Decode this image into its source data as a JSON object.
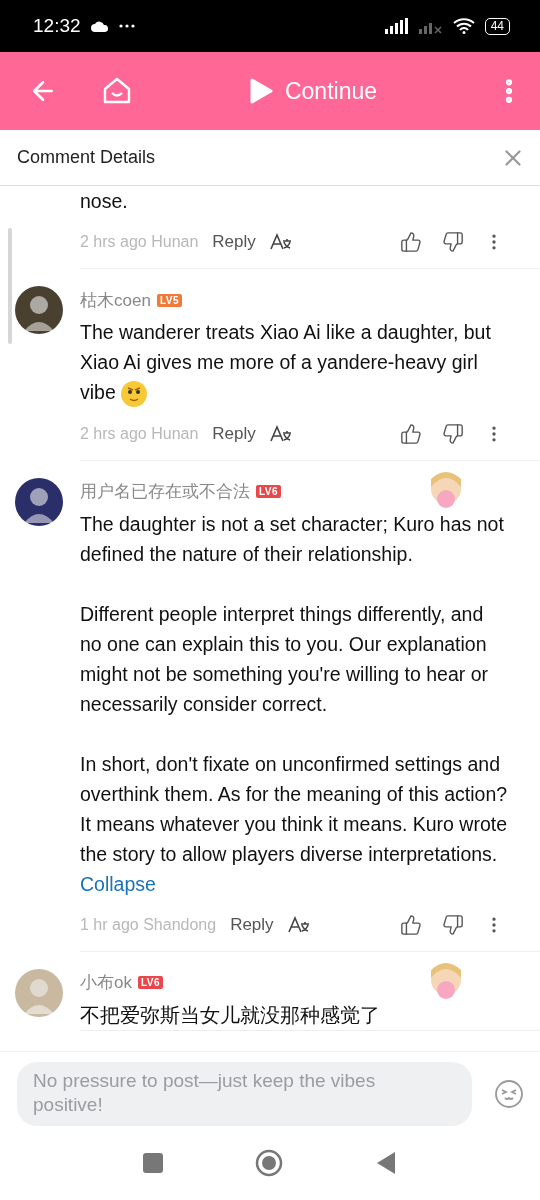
{
  "status_bar": {
    "time": "12:32",
    "battery": "44"
  },
  "header": {
    "title": "Continue"
  },
  "panel": {
    "title": "Comment Details"
  },
  "comments": [
    {
      "kind": "partial",
      "paragraphs": [
        "nose."
      ],
      "time": "2 hrs ago",
      "location": "Hunan",
      "reply": "Reply"
    },
    {
      "kind": "full",
      "user": "枯木coen",
      "badge": {
        "text": "LV5",
        "color": "#f07a3a"
      },
      "sticker": false,
      "emoji": true,
      "paragraphs": [
        "The wanderer treats Xiao Ai like a daughter, but Xiao Ai gives me more of a yandere-heavy girl vibe"
      ],
      "time": "2 hrs ago",
      "location": "Hunan",
      "reply": "Reply"
    },
    {
      "kind": "full",
      "user": "用户名已存在或不合法",
      "badge": {
        "text": "LV6",
        "color": "#e8474b"
      },
      "sticker": true,
      "emoji": false,
      "paragraphs": [
        "The daughter is not a set character; Kuro has not defined the nature of their relationship.",
        "Different people interpret things differently, and no one can explain this to you. Our explanation might not be something you're willing to hear or necessarily consider correct.",
        "In short, don't fixate on unconfirmed settings and overthink them. As for the meaning of this action? It means whatever you think it means. Kuro wrote the story to allow players diverse interpretations."
      ],
      "collapse": "Collapse",
      "time": "1 hr ago",
      "location": "Shandong",
      "reply": "Reply"
    },
    {
      "kind": "full",
      "user": "小布ok",
      "badge": {
        "text": "LV6",
        "color": "#e8474b"
      },
      "sticker": true,
      "emoji": false,
      "paragraphs": [
        "不把爱弥斯当女儿就没那种感觉了"
      ]
    }
  ],
  "composer": {
    "placeholder": "No pressure to post—just keep the vibes positive!"
  }
}
